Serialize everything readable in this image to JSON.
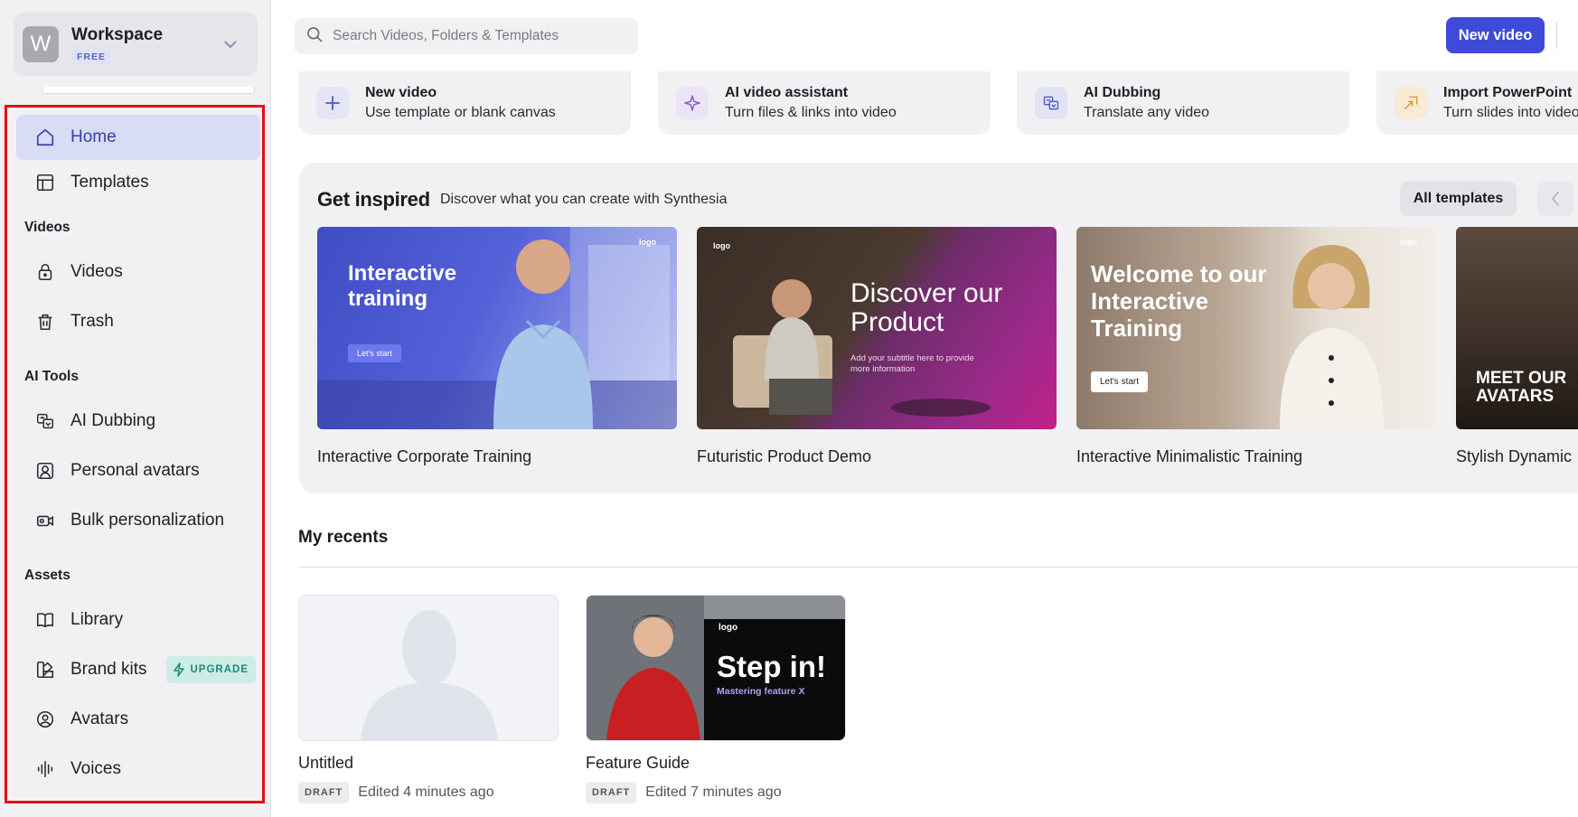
{
  "workspace": {
    "initial": "W",
    "name": "Workspace",
    "plan": "FREE"
  },
  "sidebar": {
    "top_items": [
      {
        "label": "Home",
        "icon": "home-icon",
        "active": true
      },
      {
        "label": "Templates",
        "icon": "templates-icon"
      }
    ],
    "sections": [
      {
        "title": "Videos",
        "items": [
          {
            "label": "Videos",
            "icon": "lock-icon"
          },
          {
            "label": "Trash",
            "icon": "trash-icon"
          }
        ]
      },
      {
        "title": "AI Tools",
        "items": [
          {
            "label": "AI Dubbing",
            "icon": "dubbing-icon"
          },
          {
            "label": "Personal avatars",
            "icon": "avatar-icon"
          },
          {
            "label": "Bulk personalization",
            "icon": "video-camera-icon"
          }
        ]
      },
      {
        "title": "Assets",
        "items": [
          {
            "label": "Library",
            "icon": "book-icon"
          },
          {
            "label": "Brand kits",
            "icon": "brand-kit-icon",
            "badge": "UPGRADE"
          },
          {
            "label": "Avatars",
            "icon": "user-circle-icon"
          },
          {
            "label": "Voices",
            "icon": "waveform-icon"
          }
        ]
      }
    ]
  },
  "search": {
    "placeholder": "Search Videos, Folders & Templates"
  },
  "header": {
    "new_video_label": "New video"
  },
  "quick_actions": [
    {
      "title": "New video",
      "subtitle": "Use template or blank canvas",
      "icon": "plus-icon"
    },
    {
      "title": "AI video assistant",
      "subtitle": "Turn files & links into video",
      "icon": "sparkle-icon"
    },
    {
      "title": "AI Dubbing",
      "subtitle": "Translate any video",
      "icon": "dubbing-icon"
    },
    {
      "title": "Import PowerPoint",
      "subtitle": "Turn slides into video",
      "icon": "import-icon"
    }
  ],
  "inspired": {
    "title": "Get inspired",
    "subtitle": "Discover what you can create with Synthesia",
    "all_templates_label": "All templates",
    "templates": [
      {
        "name": "Interactive Corporate Training",
        "headline": "Interactive training",
        "cta": "Let's start",
        "logo": "logo"
      },
      {
        "name": "Futuristic Product Demo",
        "headline": "Discover our Product",
        "caption": "Add your subtitle here to provide more information",
        "logo": "logo"
      },
      {
        "name": "Interactive Minimalistic Training",
        "headline": "Welcome to our Interactive Training",
        "cta": "Let's start",
        "logo": "logo"
      },
      {
        "name": "Stylish Dynamic",
        "headline": "MEET OUR AVATARS"
      }
    ]
  },
  "recents": {
    "title": "My recents",
    "items": [
      {
        "name": "Untitled",
        "status": "DRAFT",
        "edited": "Edited 4 minutes ago"
      },
      {
        "name": "Feature Guide",
        "status": "DRAFT",
        "edited": "Edited 7 minutes ago",
        "headline": "Step in!",
        "caption": "Mastering feature X",
        "logo": "logo"
      }
    ]
  },
  "colors": {
    "accent": "#3d4bd8",
    "active_nav": "#d8dcf4",
    "highlight_border": "#e3101a",
    "upgrade": "#1d8a78"
  }
}
